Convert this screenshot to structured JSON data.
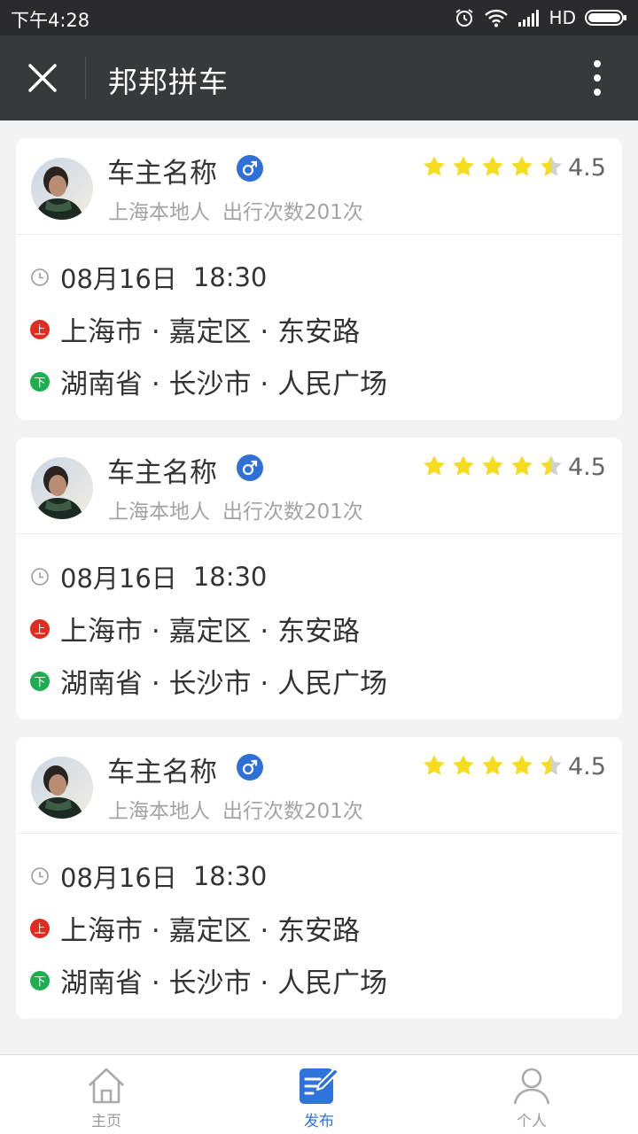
{
  "statusbar": {
    "time": "下午4:28",
    "network": "HD"
  },
  "header": {
    "title": "邦邦拼车"
  },
  "rides": [
    {
      "driver_name": "车主名称",
      "hometown": "上海本地人",
      "trips": "出行次数201次",
      "rating": "4.5",
      "date": "08月16日",
      "time": "18:30",
      "from": "上海市 · 嘉定区 · 东安路",
      "to": "湖南省 · 长沙市 · 人民广场",
      "from_badge": "上",
      "to_badge": "下"
    },
    {
      "driver_name": "车主名称",
      "hometown": "上海本地人",
      "trips": "出行次数201次",
      "rating": "4.5",
      "date": "08月16日",
      "time": "18:30",
      "from": "上海市 · 嘉定区 · 东安路",
      "to": "湖南省 · 长沙市 · 人民广场",
      "from_badge": "上",
      "to_badge": "下"
    },
    {
      "driver_name": "车主名称",
      "hometown": "上海本地人",
      "trips": "出行次数201次",
      "rating": "4.5",
      "date": "08月16日",
      "time": "18:30",
      "from": "上海市 · 嘉定区 · 东安路",
      "to": "湖南省 · 长沙市 · 人民广场",
      "from_badge": "上",
      "to_badge": "下"
    }
  ],
  "tabs": [
    {
      "label": "主页",
      "icon": "home-icon",
      "active": false
    },
    {
      "label": "发布",
      "icon": "edit-icon",
      "active": true
    },
    {
      "label": "个人",
      "icon": "person-icon",
      "active": false
    }
  ],
  "colors": {
    "star": "#f5dc1e",
    "accent": "#2f74dd",
    "start_badge": "#e02b1f",
    "end_badge": "#1cae4f"
  }
}
